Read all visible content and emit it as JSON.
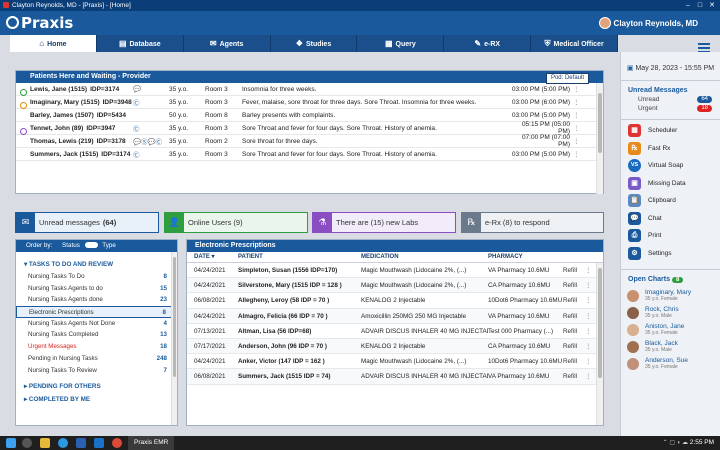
{
  "window": {
    "title": "Clayton Reynolds, MD - [Praxis] - [Home]"
  },
  "header": {
    "logo": "Praxis",
    "user": "Clayton Reynolds, MD"
  },
  "nav": {
    "tabs": [
      {
        "label": "Home",
        "icon": "home-icon",
        "glyph": "⌂"
      },
      {
        "label": "Database",
        "icon": "database-icon",
        "glyph": "▤"
      },
      {
        "label": "Agents",
        "icon": "agents-icon",
        "glyph": "✉"
      },
      {
        "label": "Studies",
        "icon": "studies-icon",
        "glyph": "❖"
      },
      {
        "label": "Query",
        "icon": "query-icon",
        "glyph": "▦"
      },
      {
        "label": "e-RX",
        "icon": "erx-icon",
        "glyph": "✎"
      },
      {
        "label": "Medical Officer",
        "icon": "medical-officer-icon",
        "glyph": "⛨"
      }
    ]
  },
  "waiting": {
    "title": "Patients Here and Waiting - Provider",
    "pod_button": "Pod: Default",
    "rows": [
      {
        "name": "Lewis, Jane (1515)",
        "idp": "IDP=3174",
        "flags": "💬",
        "age": "35 y.o.",
        "room": "Room 3",
        "reason": "Insomnia for three weeks.",
        "time": "03:00 PM (5:00 PM)",
        "dot": "#2e9e3e"
      },
      {
        "name": "Imaginary, Mary (1515)",
        "idp": "IDP=3948",
        "flags": "Ⓒ",
        "age": "35 y.o.",
        "room": "Room 3",
        "reason": "Fever, malaise, sore throat for three days. Sore Throat.   Insomnia for three weeks.",
        "time": "03:00 PM (6:00 PM)",
        "dot": "#e08a00"
      },
      {
        "name": "Barley, James (1507)",
        "idp": "IDP=5434",
        "flags": "",
        "age": "50 y.o.",
        "room": "Room 8",
        "reason": "Barley presents with complaints.",
        "time": "03:00 PM (5:00 PM)",
        "dot": ""
      },
      {
        "name": "Tennet, John (89)",
        "idp": "IDP=3947",
        "flags": "Ⓒ",
        "age": "35 y.o.",
        "room": "Room 3",
        "reason": "Sore Throat and fever for four days. Sore Throat. History of anemia.",
        "time": "05:15 PM (05:00 PM)",
        "dot": "#8a4ec2"
      },
      {
        "name": "Thomas, Lewis (219)",
        "idp": "IDP=3178",
        "flags": "💬Ⓢ💬Ⓒ",
        "age": "35 y.o.",
        "room": "Room 2",
        "reason": "Sore throat for three days.",
        "time": "07:00 PM (07:00 PM)",
        "dot": ""
      },
      {
        "name": "Summers, Jack (1515)",
        "idp": "IDP=3174",
        "flags": "Ⓒ",
        "age": "35 y.o.",
        "room": "Room 3",
        "reason": "Sore Throat and fever for four days. Sore Throat. History of anemia.",
        "time": "03:00 PM (5:00 PM)",
        "dot": ""
      }
    ]
  },
  "tiles": [
    {
      "label": "Unread messages",
      "count": "(64)",
      "glyph": "✉",
      "color": "#1a5a9c"
    },
    {
      "label": "Online Users (9)",
      "glyph": "👤",
      "color": "#2e9e3e"
    },
    {
      "label": "There are (15) new Labs",
      "glyph": "⚗",
      "color": "#8a4ec2"
    },
    {
      "label": "e-Rx (8) to respond",
      "glyph": "℞",
      "color": "#6a7a8c"
    }
  ],
  "tasks": {
    "order_by": "Order by:",
    "status": "Status",
    "type": "Type",
    "group1": "TASKS TO DO AND REVIEW",
    "items": [
      {
        "label": "Nursing Tasks To Do",
        "count": "8"
      },
      {
        "label": "Nursing Tasks Agents to do",
        "count": "15"
      },
      {
        "label": "Nursing Tasks Agents done",
        "count": "23"
      },
      {
        "label": "Electronic Prescriptions",
        "count": "8",
        "selected": true
      },
      {
        "label": "Nursing Tasks Agents Not Done",
        "count": "4"
      },
      {
        "label": "Nursing Tasks Completed",
        "count": "13"
      },
      {
        "label": "Urgent Messages",
        "count": "18",
        "red": true
      },
      {
        "label": "Pending in Nursing Tasks",
        "count": "248"
      },
      {
        "label": "Nursing Tasks To Review",
        "count": "7"
      }
    ],
    "group2": "PENDING FOR OTHERS",
    "group3": "COMPLETED BY ME"
  },
  "rx": {
    "title": "Electronic Prescriptions",
    "cols": [
      "DATE ▾",
      "PATIENT",
      "MEDICATION",
      "PHARMACY"
    ],
    "rows": [
      {
        "date": "04/24/2021",
        "patient": "Simpleton, Susan (1556 IDP=170)",
        "med": "Magic Mouthwash (Lidocaine 2%, (...)",
        "pharm": "VA Pharmacy 10.6MU",
        "type": "Refill"
      },
      {
        "date": "04/24/2021",
        "patient": "Silverstone, Mary (1515 IDP = 128 )",
        "med": "Magic Mouthwash (Lidocaine 2%, (...)",
        "pharm": "CA Pharmacy 10.6MU",
        "type": "Refill"
      },
      {
        "date": "06/08/2021",
        "patient": "Allegheny, Leroy (58 IDP = 70 )",
        "med": "KENALOG 2 Injectable",
        "pharm": "10Dot6 Pharmacy 10.6MU",
        "type": "Refill"
      },
      {
        "date": "04/24/2021",
        "patient": "Almagro, Felicia (66 IDP = 70 )",
        "med": "Amoxicillin 250MG 250 MG Injectable",
        "pharm": "VA Pharmacy 10.6MU",
        "type": "Refill"
      },
      {
        "date": "07/13/2021",
        "patient": "Altman, Lisa (56 IDP=68)",
        "med": "ADVAIR DISCUS INHALER 40 MG INJECTABLE",
        "pharm": "Test 000 Pharmacy (...)",
        "type": "Refill"
      },
      {
        "date": "07/17/2021",
        "patient": "Anderson, John (96 IDP = 70 )",
        "med": "KENALOG 2 Injectable",
        "pharm": "CA Pharmacy 10.6MU",
        "type": "Refill"
      },
      {
        "date": "04/24/2021",
        "patient": "Anker, Victor (147 IDP = 162 )",
        "med": "Magic Mouthwash (Lidocaine 2%, (...)",
        "pharm": "10Dot6 Pharmacy 10.6MU",
        "type": "Refill"
      },
      {
        "date": "06/08/2021",
        "patient": "Summers, Jack (1515 IDP = 74)",
        "med": "ADVAIR DISCUS INHALER 40 MG INJECTABLE",
        "pharm": "VA Pharmacy 10.6MU",
        "type": "Refill"
      }
    ]
  },
  "side": {
    "date": "May 28, 2023 - 15:55 PM",
    "unread_title": "Unread Messages",
    "unread": [
      {
        "label": "Unread",
        "count": "64"
      },
      {
        "label": "Urgent",
        "count": "18"
      }
    ],
    "menu": [
      {
        "label": "Scheduler",
        "icon": "calendar-icon",
        "glyph": "▦",
        "color": "#d33"
      },
      {
        "label": "Fast Rx",
        "icon": "rx-icon",
        "glyph": "℞",
        "color": "#e88a1a"
      },
      {
        "label": "Virtual Soap",
        "icon": "vs-icon",
        "glyph": "VS",
        "color": "#1a6bc0"
      },
      {
        "label": "Missing Data",
        "icon": "missing-data-icon",
        "glyph": "▣",
        "color": "#7a5ac8"
      },
      {
        "label": "Clipboard",
        "icon": "clipboard-icon",
        "glyph": "📋",
        "color": "#5a8ac0"
      },
      {
        "label": "Chat",
        "icon": "chat-icon",
        "glyph": "💬",
        "color": "#1a5a9c"
      },
      {
        "label": "Print",
        "icon": "print-icon",
        "glyph": "⎙",
        "color": "#1a5a9c"
      },
      {
        "label": "Settings",
        "icon": "settings-icon",
        "glyph": "⚙",
        "color": "#1a5a9c"
      }
    ],
    "open_charts_title": "Open Charts",
    "open_charts_count": "8",
    "charts": [
      {
        "name": "Imaginary, Mary",
        "sub": "35 y.o. Female"
      },
      {
        "name": "Rock, Chris",
        "sub": "35 y.o. Male"
      },
      {
        "name": "Aniston, Jane",
        "sub": "35 y.o. Female"
      },
      {
        "name": "Black, Jack",
        "sub": "35 y.o. Male"
      },
      {
        "name": "Anderson, Sue",
        "sub": "35 y.o. Female"
      }
    ]
  },
  "taskbar": {
    "app": "Praxis EMR",
    "time": "2:55 PM"
  }
}
